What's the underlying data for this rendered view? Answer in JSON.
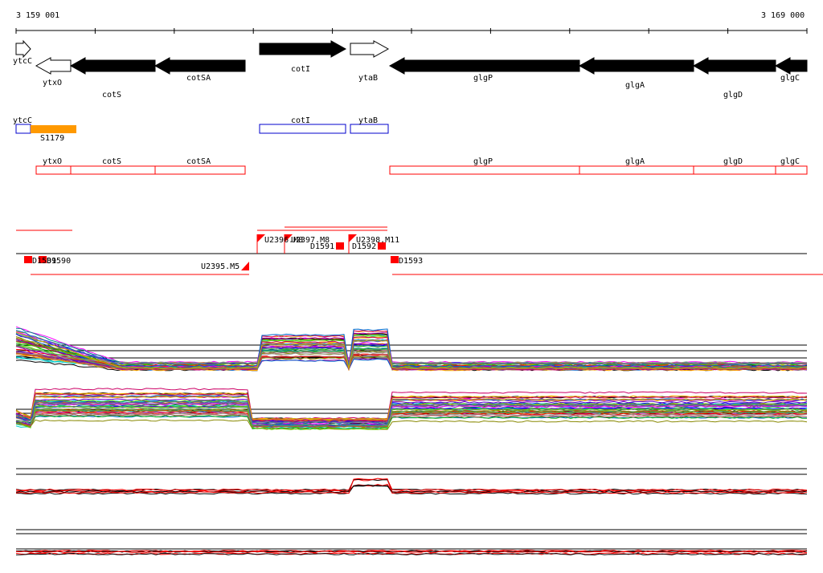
{
  "ruler": {
    "start_label": "3 159 001",
    "end_label": "3 169 000"
  },
  "genes_top": [
    {
      "name": "ytcC",
      "strand": "+",
      "fill": "white"
    },
    {
      "name": "ytxO",
      "strand": "-",
      "fill": "white"
    },
    {
      "name": "cotS",
      "strand": "-",
      "fill": "black"
    },
    {
      "name": "cotSA",
      "strand": "-",
      "fill": "black"
    },
    {
      "name": "cotI",
      "strand": "+",
      "fill": "black"
    },
    {
      "name": "ytaB",
      "strand": "+",
      "fill": "white"
    },
    {
      "name": "glgP",
      "strand": "-",
      "fill": "black"
    },
    {
      "name": "glgA",
      "strand": "-",
      "fill": "black"
    },
    {
      "name": "glgD",
      "strand": "-",
      "fill": "black"
    },
    {
      "name": "glgC",
      "strand": "-",
      "fill": "black"
    }
  ],
  "blue_track": [
    "ytcC",
    "cotI",
    "ytaB"
  ],
  "orange_track": {
    "label": "S1179",
    "color": "#ff9900"
  },
  "red_track": [
    "ytxO",
    "cotS",
    "cotSA",
    "glgP",
    "glgA",
    "glgD",
    "glgC"
  ],
  "features": {
    "upstream": [
      "U2396.M8",
      "U2397.M8",
      "U2398.M11"
    ],
    "downstream_labels": [
      "D1589",
      "D1590",
      "D1591",
      "D1592",
      "D1593"
    ],
    "below_left": "U2395.M5"
  },
  "colors": {
    "plus_arrow": "#ffffff",
    "minus_arrow": "#000000",
    "blue": "#0000cc",
    "red": "#ff0000",
    "orange": "#ff9900"
  }
}
